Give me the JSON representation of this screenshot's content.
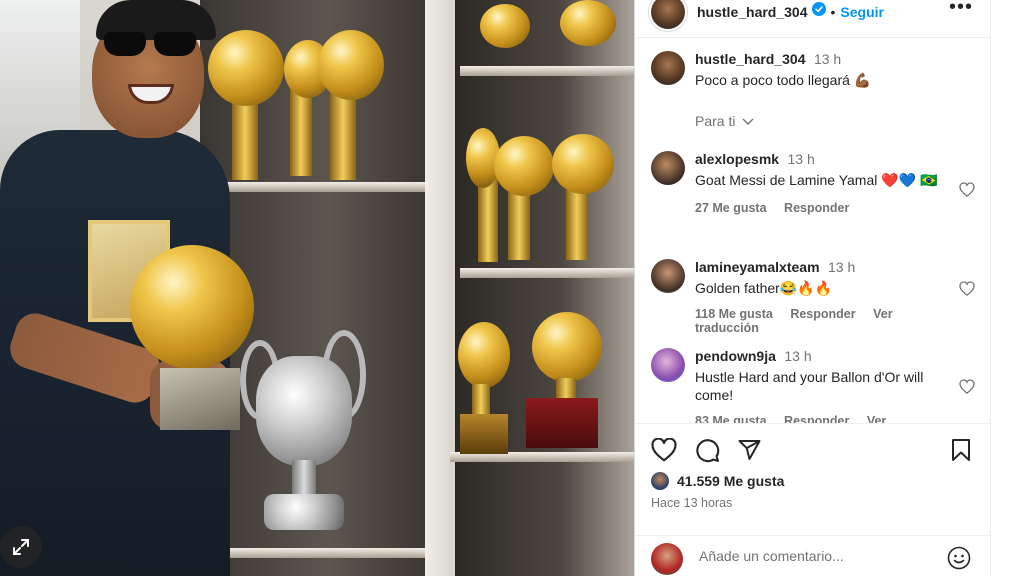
{
  "post": {
    "author": "hustle_hard_304",
    "follow_label": "Seguir",
    "more_label": "•••",
    "separator": "•",
    "caption_time": "13 h",
    "caption_text": "Poco a poco todo llegará 💪🏾",
    "sort_label": "Para ti"
  },
  "comments": [
    {
      "user": "alexlopesmk",
      "time": "13 h",
      "text": "Goat Messi de Lamine Yamal ❤️💙 🇧🇷",
      "likes": "27 Me gusta",
      "reply": "Responder",
      "translate": ""
    },
    {
      "user": "lamineyamalxteam",
      "time": "13 h",
      "text": "Golden father😂🔥🔥",
      "likes": "118 Me gusta",
      "reply": "Responder",
      "translate": "Ver traducción"
    },
    {
      "user": "pendown9ja",
      "time": "13 h",
      "text": "Hustle Hard and your Ballon d'Or will come!",
      "likes": "83 Me gusta",
      "reply": "Responder",
      "translate": "Ver traducción"
    }
  ],
  "stats": {
    "likes": "41.559 Me gusta",
    "posted": "Hace 13 horas"
  },
  "composer": {
    "placeholder": "Añade un comentario..."
  },
  "icons": {
    "verified": "verified-badge-icon",
    "like": "heart-icon",
    "comment": "comment-icon",
    "share": "send-icon",
    "save": "bookmark-icon",
    "emoji": "emoji-icon",
    "expand": "expand-icon",
    "sort": "chevron-down-icon"
  },
  "colors": {
    "accent": "#0095f6",
    "text": "#262626",
    "muted": "#737373",
    "border": "#dbdbdb"
  }
}
